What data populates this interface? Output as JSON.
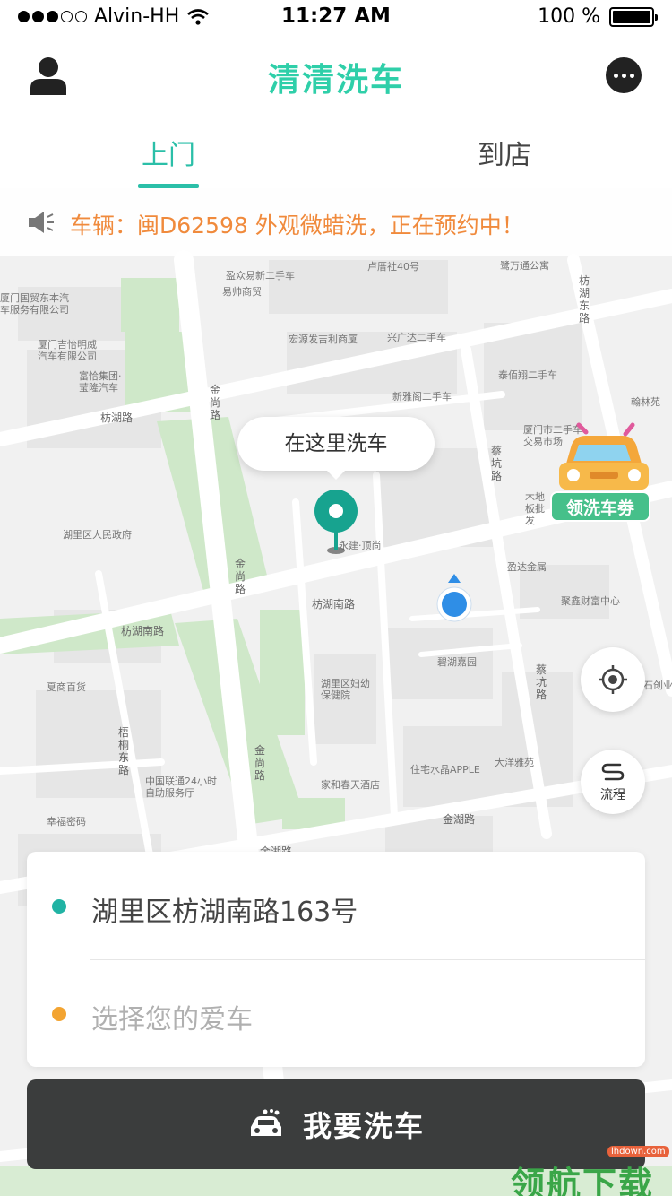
{
  "status_bar": {
    "carrier": "Alvin-HH",
    "time": "11:27 AM",
    "battery": "100 %"
  },
  "header": {
    "title": "清清洗车"
  },
  "tabs": [
    {
      "label": "上门",
      "active": true
    },
    {
      "label": "到店",
      "active": false
    }
  ],
  "notice": {
    "text": "车辆：闽D62598 外观微蜡洗，正在预约中！"
  },
  "map": {
    "pin_label": "在这里洗车",
    "coupon_label": "领洗车劵",
    "process_label": "流程",
    "pois": [
      "盈众易新二手车",
      "卢厝社40号",
      "鹭万通公寓",
      "易帅商贸",
      "宏源发吉利商厦",
      "兴广达二手车",
      "厦门国贸东本汽车服务有限公司",
      "厦门吉怡明威汽车有限公司",
      "富恰集团·莹隆汽车",
      "新雅阁二手车",
      "泰佰翔二手车",
      "翰林苑",
      "厦门市二手车交易市场",
      "湖里区人民政府",
      "永建·顶尚",
      "木地板批发",
      "盈达金属",
      "聚鑫财富中心",
      "碧湖嘉园",
      "湖里区妇幼保健院",
      "夏商百货",
      "大洋雅苑",
      "住宅水晶APPLE",
      "家和春天酒店",
      "中国联通24小时自助服务厅",
      "幸福密码",
      "石创业"
    ],
    "roads": [
      "枋湖路",
      "枋湖南路",
      "枋湖南路",
      "金尚路",
      "金尚路",
      "金尚路",
      "枋湖东路",
      "蔡坑路",
      "蔡坑路",
      "梧桐东路",
      "金湖路",
      "金湖路"
    ]
  },
  "form": {
    "address": "湖里区枋湖南路163号",
    "car_placeholder": "选择您的爱车"
  },
  "action": {
    "wash_label": "我要洗车"
  },
  "watermark": {
    "text": "领航下载",
    "url": "lhdown.com"
  },
  "colors": {
    "brand": "#2fcfa9",
    "notice": "#f08a3c",
    "button": "#3b3d3d"
  }
}
